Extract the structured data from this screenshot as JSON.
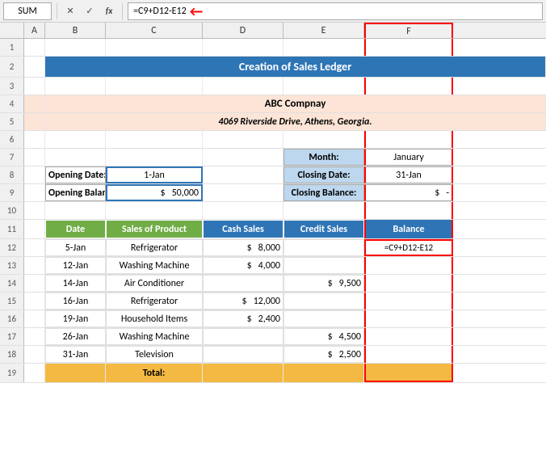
{
  "toolbar": {
    "name_box": "SUM",
    "cancel_icon": "✕",
    "confirm_icon": "✓",
    "function_icon": "fx",
    "formula": "=C9+D12-E12",
    "arrow": "←"
  },
  "columns": {
    "headers": [
      "A",
      "B",
      "C",
      "D",
      "E",
      "F"
    ]
  },
  "rows": {
    "r1": {
      "num": "1"
    },
    "r2": {
      "num": "2",
      "title": "Creation of Sales Ledger"
    },
    "r3": {
      "num": "3"
    },
    "r4": {
      "num": "4",
      "company": "ABC Compnay"
    },
    "r5": {
      "num": "5",
      "address": "4069 Riverside Drive, Athens, Georgia."
    },
    "r6": {
      "num": "6"
    },
    "r7": {
      "num": "7",
      "month_label": "Month:",
      "month_val": "January"
    },
    "r8": {
      "num": "8",
      "open_date_label": "Opening Date:",
      "open_date_val": "1-Jan",
      "close_date_label": "Closing Date:",
      "close_date_val": "31-Jan"
    },
    "r9": {
      "num": "9",
      "open_bal_label": "Opening Balance:",
      "open_bal_dollar": "$",
      "open_bal_val": "50,000",
      "close_bal_label": "Closing Balance:",
      "close_bal_dollar": "$",
      "close_bal_val": "-"
    },
    "r10": {
      "num": "10"
    },
    "r11": {
      "num": "11",
      "h_date": "Date",
      "h_product": "Sales of Product",
      "h_cash": "Cash Sales",
      "h_credit": "Credit Sales",
      "h_balance": "Balance"
    },
    "r12": {
      "num": "12",
      "date": "5-Jan",
      "product": "Refrigerator",
      "cash_dollar": "$",
      "cash_val": "8,000",
      "formula_val": "=C9+D12-E12"
    },
    "r13": {
      "num": "13",
      "date": "12-Jan",
      "product": "Washing Machine",
      "cash_dollar": "$",
      "cash_val": "4,000"
    },
    "r14": {
      "num": "14",
      "date": "14-Jan",
      "product": "Air Conditioner",
      "credit_dollar": "$",
      "credit_val": "9,500"
    },
    "r15": {
      "num": "15",
      "date": "16-Jan",
      "product": "Refrigerator",
      "cash_dollar": "$",
      "cash_val": "12,000"
    },
    "r16": {
      "num": "16",
      "date": "19-Jan",
      "product": "Household Items",
      "cash_dollar": "$",
      "cash_val": "2,400"
    },
    "r17": {
      "num": "17",
      "date": "26-Jan",
      "product": "Washing Machine",
      "credit_dollar": "$",
      "credit_val": "4,500"
    },
    "r18": {
      "num": "18",
      "date": "31-Jan",
      "product": "Television",
      "credit_dollar": "$",
      "credit_val": "2,500"
    },
    "r19": {
      "num": "19",
      "total_label": "Total:"
    }
  },
  "colors": {
    "header_blue": "#2E75B6",
    "light_orange": "#FCE4D6",
    "orange_accent": "#F4B942",
    "green": "#375623",
    "header_green": "#70AD47",
    "teal": "#2F75B6",
    "light_teal": "#BDD7EE",
    "red": "#FF0000"
  }
}
